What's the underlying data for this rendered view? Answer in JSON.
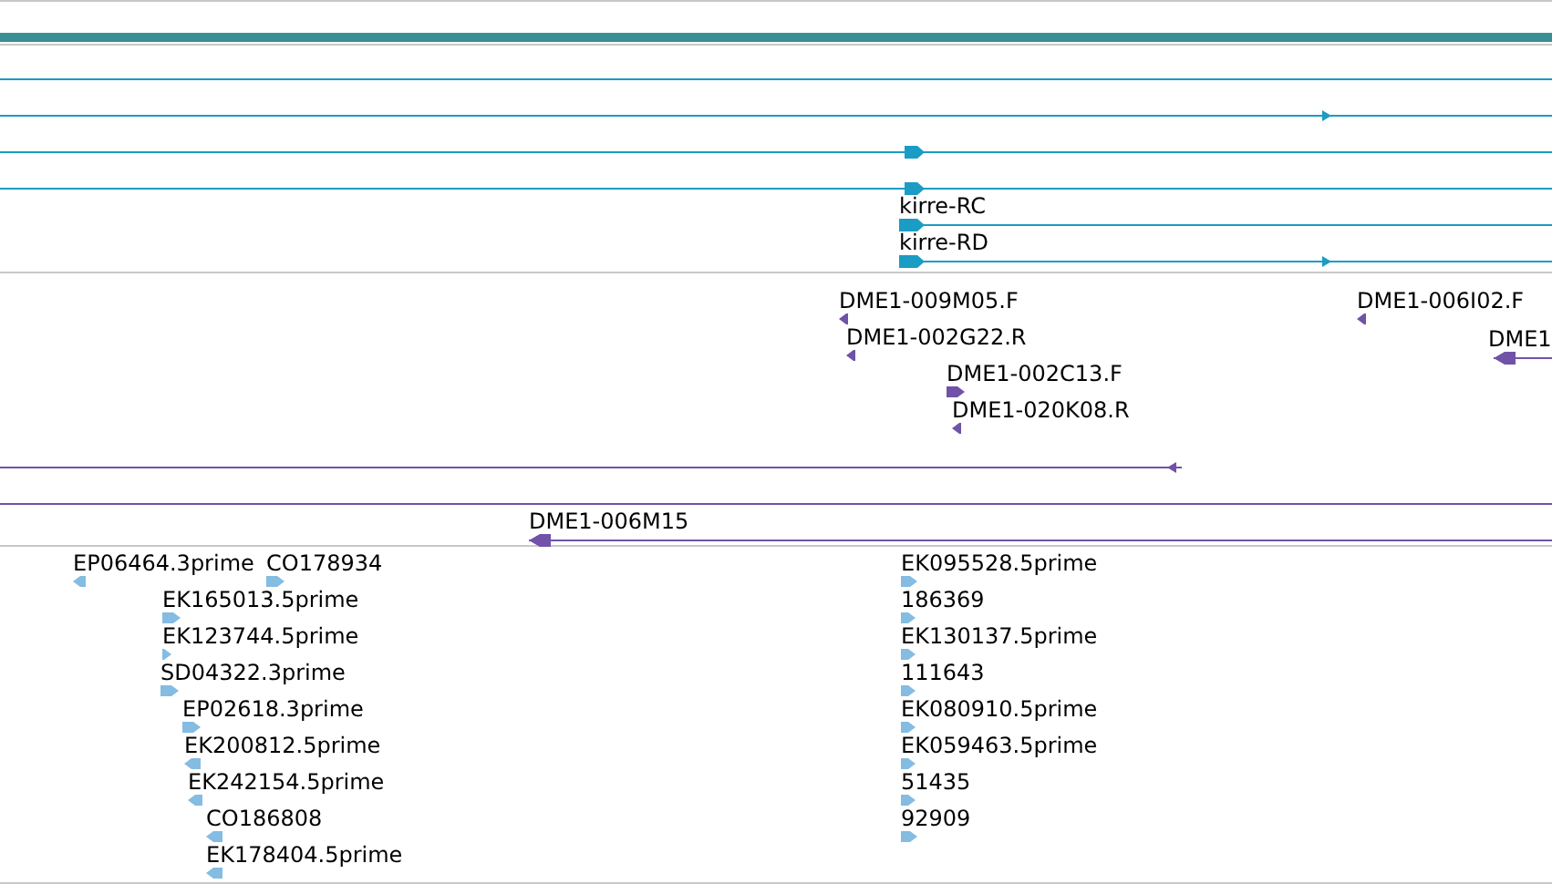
{
  "tracks": [
    {
      "kind": "gene",
      "features": [
        {
          "kind": "line"
        },
        {
          "kind": "line",
          "reverse": false
        },
        {
          "kind": "line",
          "reverse": false
        },
        {
          "kind": "line",
          "reverse": false
        },
        {
          "kind": "line",
          "label": "kirre-RC",
          "reverse": false
        },
        {
          "kind": "line",
          "label": "kirre-RD",
          "reverse": false
        }
      ]
    },
    {
      "kind": "clone",
      "features": [
        {
          "kind": "marker",
          "label": "DME1-009M05.F",
          "reverse": true
        },
        {
          "kind": "marker",
          "label": "DME1-006I02.F",
          "reverse": true
        },
        {
          "kind": "marker",
          "label": "DME1-002G22.R",
          "reverse": true
        },
        {
          "kind": "line",
          "label": "DME1",
          "reverse": true
        },
        {
          "kind": "marker",
          "label": "DME1-002C13.F",
          "reverse": false
        },
        {
          "kind": "marker",
          "label": "DME1-020K08.R",
          "reverse": true
        },
        {
          "kind": "line",
          "reverse": true
        },
        {
          "kind": "line"
        },
        {
          "kind": "line",
          "label": "DME1-006M15",
          "reverse": true
        }
      ]
    },
    {
      "kind": "est",
      "features": [
        {
          "kind": "marker",
          "label": "EP06464.3prime",
          "reverse": true
        },
        {
          "kind": "marker",
          "label": "CO178934",
          "reverse": false
        },
        {
          "kind": "marker",
          "label": "EK095528.5prime",
          "reverse": false
        },
        {
          "kind": "marker",
          "label": "EK165013.5prime",
          "reverse": false
        },
        {
          "kind": "marker",
          "label": "186369",
          "reverse": false
        },
        {
          "kind": "marker",
          "label": "EK123744.5prime",
          "reverse": false
        },
        {
          "kind": "marker",
          "label": "EK130137.5prime",
          "reverse": false
        },
        {
          "kind": "marker",
          "label": "SD04322.3prime",
          "reverse": false
        },
        {
          "kind": "marker",
          "label": "111643",
          "reverse": false
        },
        {
          "kind": "marker",
          "label": "EP02618.3prime",
          "reverse": false
        },
        {
          "kind": "marker",
          "label": "EK080910.5prime",
          "reverse": false
        },
        {
          "kind": "marker",
          "label": "EK200812.5prime",
          "reverse": true
        },
        {
          "kind": "marker",
          "label": "EK059463.5prime",
          "reverse": false
        },
        {
          "kind": "marker",
          "label": "EK242154.5prime",
          "reverse": true
        },
        {
          "kind": "marker",
          "label": "51435",
          "reverse": false
        },
        {
          "kind": "marker",
          "label": "CO186808",
          "reverse": true
        },
        {
          "kind": "marker",
          "label": "92909",
          "reverse": false
        },
        {
          "kind": "marker",
          "label": "EK178404.5prime",
          "reverse": true
        }
      ]
    }
  ]
}
